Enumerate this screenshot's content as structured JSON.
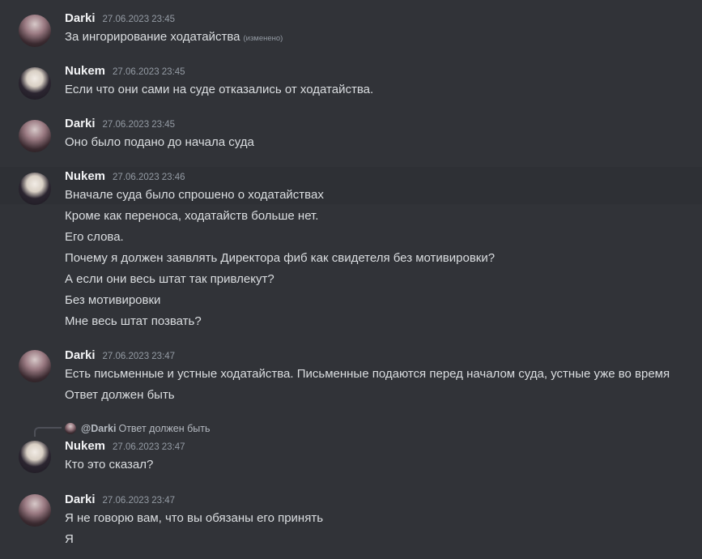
{
  "colors": {
    "background": "#313338",
    "username": "#f2f3f5",
    "text": "#dbdee1",
    "muted": "#949ba4"
  },
  "messages": [
    {
      "author": "Darki",
      "timestamp": "27.06.2023 23:45",
      "lines": [
        "За ингорирование ходатайства"
      ],
      "edited_label": "(изменено)"
    },
    {
      "author": "Nukem",
      "timestamp": "27.06.2023 23:45",
      "lines": [
        "Если что они сами на суде отказались от ходатайства."
      ]
    },
    {
      "author": "Darki",
      "timestamp": "27.06.2023 23:45",
      "lines": [
        "Оно было подано до начала суда"
      ]
    },
    {
      "author": "Nukem",
      "timestamp": "27.06.2023 23:46",
      "lines": [
        "Вначале суда было спрошено о ходатайствах",
        "Кроме как переноса, ходатайств больше нет.",
        "Его слова.",
        "Почему я должен заявлять Директора фиб как свидетеля без мотивировки?",
        "А если они весь штат так привлекут?",
        "Без мотивировки",
        "Мне весь штат позвать?"
      ]
    },
    {
      "author": "Darki",
      "timestamp": "27.06.2023 23:47",
      "lines": [
        "Есть письменные и устные ходатайства. Письменные подаются перед началом суда, устные уже во время",
        "Ответ должен быть"
      ]
    },
    {
      "author": "Nukem",
      "timestamp": "27.06.2023 23:47",
      "reply": {
        "author": "@Darki",
        "content": "Ответ должен быть"
      },
      "lines": [
        "Кто это сказал?"
      ]
    },
    {
      "author": "Darki",
      "timestamp": "27.06.2023 23:47",
      "lines": [
        "Я не говорю вам, что вы обязаны его принять",
        "Я"
      ]
    }
  ]
}
